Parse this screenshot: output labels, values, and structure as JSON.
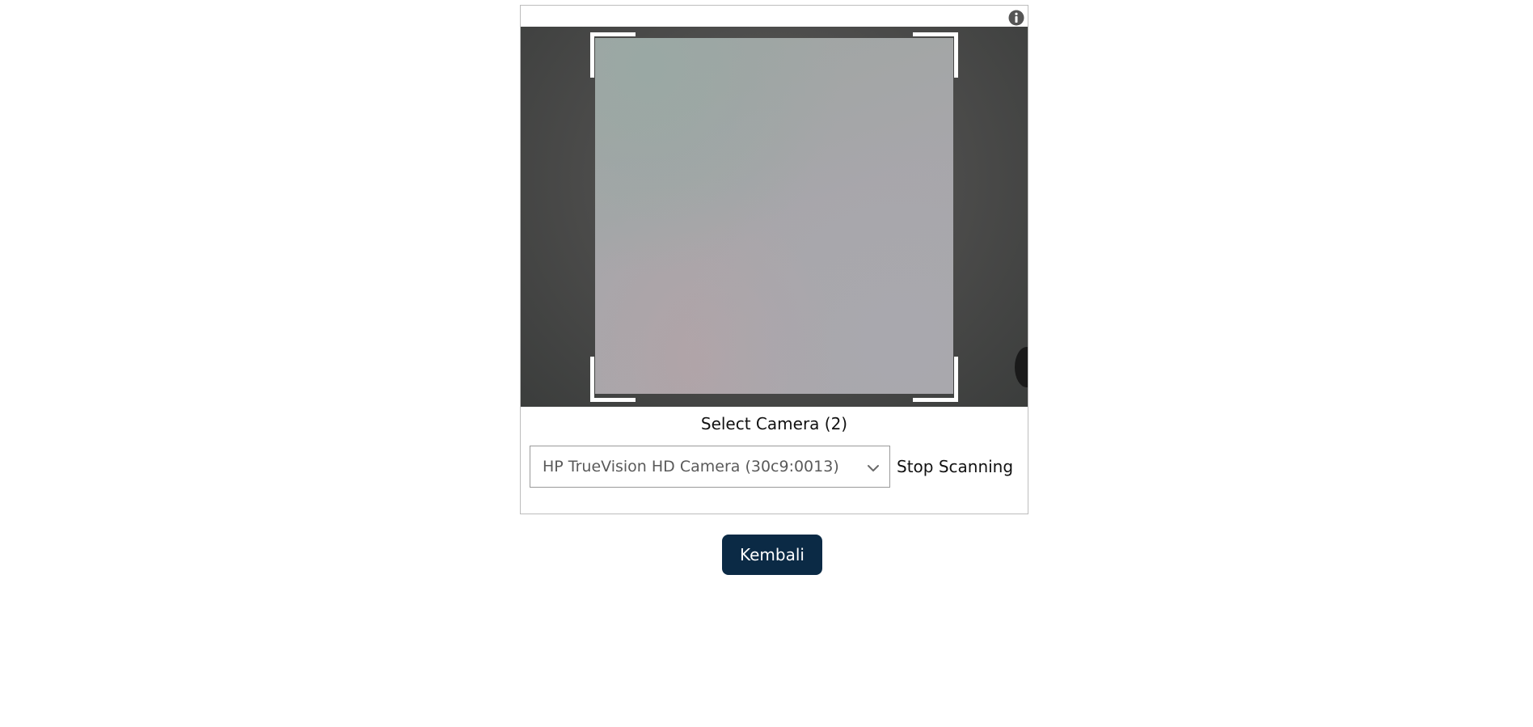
{
  "scanner": {
    "info_icon": "info-icon",
    "camera_label": "Select Camera (2)",
    "camera_select": {
      "selected": "HP TrueVision HD Camera (30c9:0013)",
      "icon": "chevron-down-icon"
    },
    "stop_label": "Stop Scanning"
  },
  "actions": {
    "back_label": "Kembali"
  },
  "colors": {
    "primary_button": "#0b2a45",
    "scan_corners": "#ffffff",
    "border": "#bdbdbd"
  }
}
